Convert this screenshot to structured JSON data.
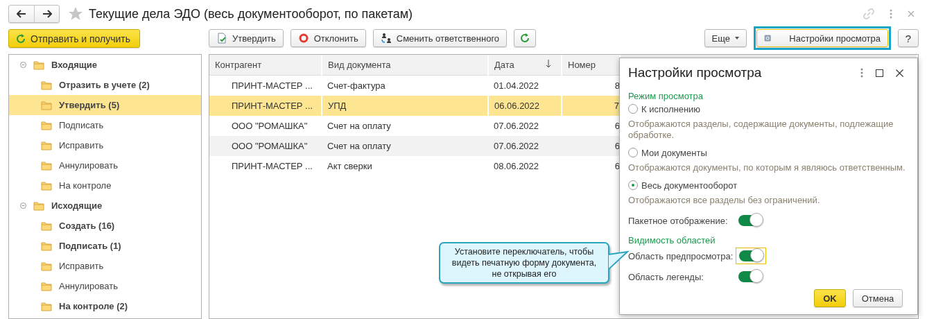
{
  "window": {
    "title": "Текущие дела ЭДО (весь документооборот, по пакетам)"
  },
  "toolbar": {
    "send_receive": "Отправить и получить",
    "actions": [
      {
        "kind": "approve",
        "label": "Утвердить"
      },
      {
        "kind": "reject",
        "label": "Отклонить"
      },
      {
        "kind": "reassign",
        "label": "Сменить ответственного"
      },
      {
        "kind": "refresh"
      }
    ],
    "more": "Еще",
    "view_settings": {
      "label": "Настройки просмотра",
      "highlighted": true
    },
    "help": "?"
  },
  "tree": [
    {
      "label": "Входящие",
      "bold": true,
      "selected": false,
      "expanded": true,
      "children": [
        {
          "label": "Отразить в учете (2)",
          "bold": true,
          "selected": false
        },
        {
          "label": "Утвердить (5)",
          "bold": true,
          "selected": true
        },
        {
          "label": "Подписать",
          "bold": false,
          "selected": false
        },
        {
          "label": "Исправить",
          "bold": false,
          "selected": false
        },
        {
          "label": "Аннулировать",
          "bold": false,
          "selected": false
        },
        {
          "label": "На контроле",
          "bold": false,
          "selected": false
        }
      ]
    },
    {
      "label": "Исходящие",
      "bold": true,
      "selected": false,
      "expanded": true,
      "children": [
        {
          "label": "Создать (16)",
          "bold": true,
          "selected": false
        },
        {
          "label": "Подписать (1)",
          "bold": true,
          "selected": false
        },
        {
          "label": "Исправить",
          "bold": false,
          "selected": false
        },
        {
          "label": "Аннулировать",
          "bold": false,
          "selected": false
        },
        {
          "label": "На контроле (2)",
          "bold": true,
          "selected": false
        }
      ]
    }
  ],
  "table": {
    "columns": [
      {
        "label": "Контрагент",
        "sorted": false
      },
      {
        "label": "Вид документа",
        "sorted": false
      },
      {
        "label": "Дата",
        "sorted": true
      },
      {
        "label": "Номер",
        "sorted": false
      }
    ],
    "rows": [
      {
        "cells": [
          "ПРИНТ-МАСТЕР ...",
          "Счет-фактура",
          "01.04.2022",
          "8"
        ],
        "selected": false,
        "hovered": false
      },
      {
        "cells": [
          "ПРИНТ-МАСТЕР ...",
          "УПД",
          "06.06.2022",
          "7"
        ],
        "selected": true,
        "hovered": false
      },
      {
        "cells": [
          "ООО \"РОМАШКА\"",
          "Счет на оплату",
          "07.06.2022",
          "6"
        ],
        "selected": false,
        "hovered": false
      },
      {
        "cells": [
          "ООО \"РОМАШКА\"",
          "Счет на оплату",
          "07.06.2022",
          "6"
        ],
        "selected": false,
        "hovered": true
      },
      {
        "cells": [
          "ПРИНТ-МАСТЕР ...",
          "Акт сверки",
          "08.06.2022",
          "6"
        ],
        "selected": false,
        "hovered": false
      }
    ]
  },
  "dialog": {
    "title": "Настройки просмотра",
    "items": [
      {
        "kind": "heading",
        "label": "Режим просмотра"
      },
      {
        "kind": "radio",
        "label": "К исполнению",
        "selected": false
      },
      {
        "kind": "note",
        "label": "Отображаются разделы, содержащие документы, подлежащие обработке."
      },
      {
        "kind": "radio",
        "label": "Мои документы",
        "selected": false
      },
      {
        "kind": "note",
        "label": "Отображаются документы, по которым я являюсь ответственным."
      },
      {
        "kind": "radio",
        "label": "Весь документооборот",
        "selected": true
      },
      {
        "kind": "note",
        "label": "Отображаются все разделы без ограничений."
      },
      {
        "kind": "toggle",
        "label": "Пакетное отображение:",
        "on": true,
        "focused": false
      },
      {
        "kind": "heading",
        "label": "Видимость областей"
      },
      {
        "kind": "toggle",
        "label": "Область предпросмотра:",
        "on": true,
        "focused": true
      },
      {
        "kind": "toggle",
        "label": "Область легенды:",
        "on": true,
        "focused": false
      }
    ],
    "buttons": [
      {
        "label": "OK",
        "default": true
      },
      {
        "label": "Отмена",
        "default": false
      }
    ]
  },
  "callout": {
    "text": "Установите переключатель, чтобы видеть печатную форму документа, не открывая его"
  }
}
